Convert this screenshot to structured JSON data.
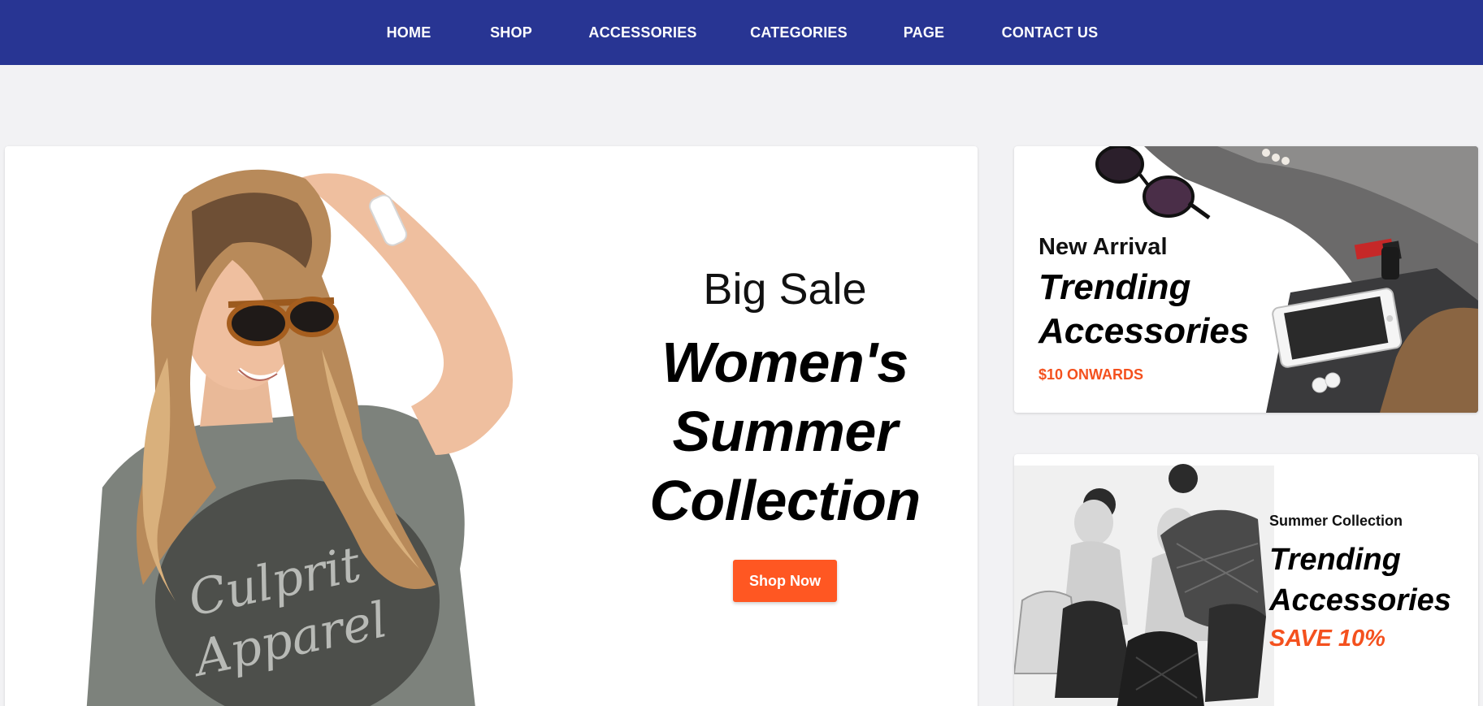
{
  "nav": {
    "items": [
      {
        "label": "HOME"
      },
      {
        "label": "SHOP"
      },
      {
        "label": "ACCESSORIES"
      },
      {
        "label": "CATEGORIES"
      },
      {
        "label": "PAGE"
      },
      {
        "label": "CONTACT US"
      }
    ]
  },
  "hero": {
    "pretitle": "Big Sale",
    "title_lines": [
      "Women's",
      "Summer",
      "Collection"
    ],
    "button_label": "Shop Now"
  },
  "promo_1": {
    "pretitle": "New Arrival",
    "title_lines": [
      "Trending",
      "Accessories"
    ],
    "tagline": "$10 ONWARDS"
  },
  "promo_2": {
    "pretitle": "Summer Collection",
    "title_lines": [
      "Trending",
      "Accessories"
    ],
    "tagline": "SAVE 10%"
  },
  "photo_text": {
    "shirt_line_1": "Culprit",
    "shirt_line_2": "Apparel"
  },
  "colors": {
    "nav_bg": "#283593",
    "accent": "#ff5722",
    "page_bg": "#f2f2f4"
  }
}
